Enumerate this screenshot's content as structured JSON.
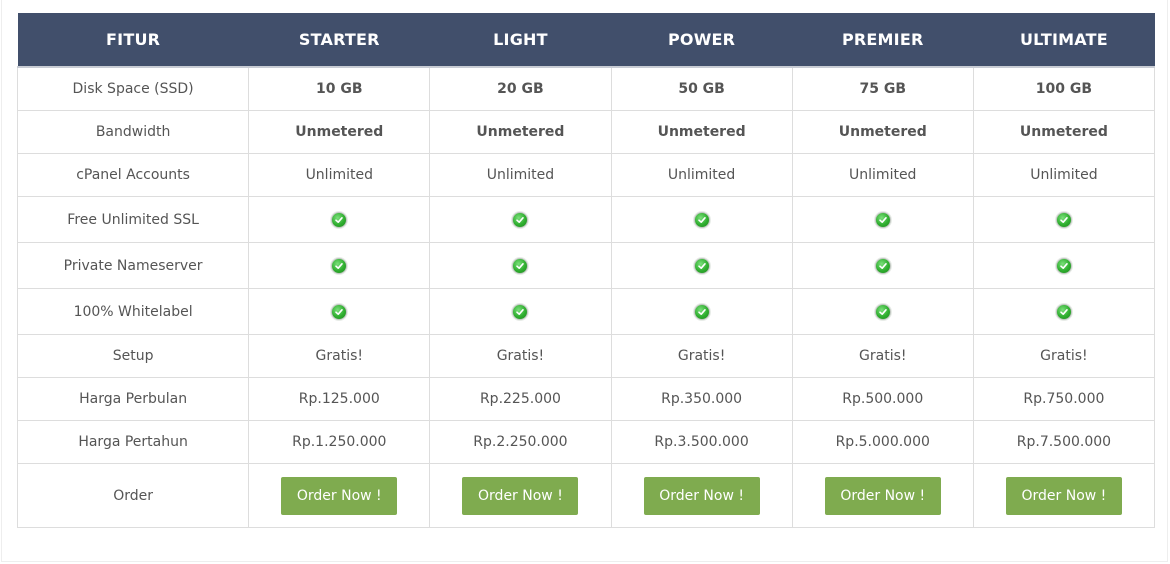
{
  "columns": [
    "FITUR",
    "STARTER",
    "LIGHT",
    "POWER",
    "PREMIER",
    "ULTIMATE"
  ],
  "rows": [
    {
      "feature": "Disk Space (SSD)",
      "type": "bold",
      "values": [
        "10 GB",
        "20 GB",
        "50 GB",
        "75 GB",
        "100 GB"
      ]
    },
    {
      "feature": "Bandwidth",
      "type": "bold",
      "values": [
        "Unmetered",
        "Unmetered",
        "Unmetered",
        "Unmetered",
        "Unmetered"
      ]
    },
    {
      "feature": "cPanel Accounts",
      "type": "text",
      "values": [
        "Unlimited",
        "Unlimited",
        "Unlimited",
        "Unlimited",
        "Unlimited"
      ]
    },
    {
      "feature": "Free Unlimited SSL",
      "type": "check",
      "values": [
        true,
        true,
        true,
        true,
        true
      ]
    },
    {
      "feature": "Private Nameserver",
      "type": "check",
      "values": [
        true,
        true,
        true,
        true,
        true
      ]
    },
    {
      "feature": "100% Whitelabel",
      "type": "check",
      "values": [
        true,
        true,
        true,
        true,
        true
      ]
    },
    {
      "feature": "Setup",
      "type": "text",
      "values": [
        "Gratis!",
        "Gratis!",
        "Gratis!",
        "Gratis!",
        "Gratis!"
      ]
    },
    {
      "feature": "Harga Perbulan",
      "type": "text",
      "values": [
        "Rp.125.000",
        "Rp.225.000",
        "Rp.350.000",
        "Rp.500.000",
        "Rp.750.000"
      ]
    },
    {
      "feature": "Harga Pertahun",
      "type": "text",
      "values": [
        "Rp.1.250.000",
        "Rp.2.250.000",
        "Rp.3.500.000",
        "Rp.5.000.000",
        "Rp.7.500.000"
      ]
    }
  ],
  "order": {
    "label": "Order",
    "button_label": "Order Now !"
  },
  "icons": {
    "check": "check-circle-icon"
  },
  "colors": {
    "header_bg": "#414f6b",
    "button_bg": "#7fab4f",
    "check_green": "#2fae2f"
  }
}
